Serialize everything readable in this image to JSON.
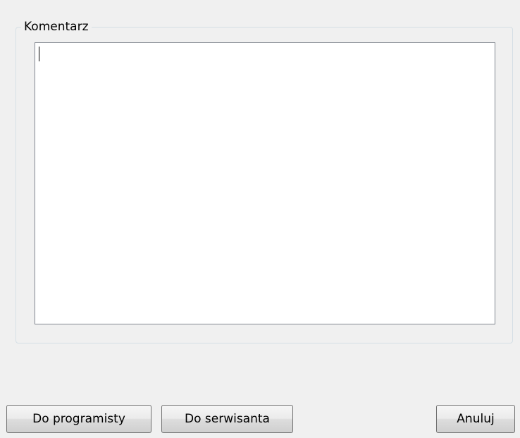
{
  "comment_group": {
    "title": "Komentarz",
    "text_value": ""
  },
  "buttons": {
    "to_programmer": "Do programisty",
    "to_servicer": "Do serwisanta",
    "cancel": "Anuluj"
  }
}
